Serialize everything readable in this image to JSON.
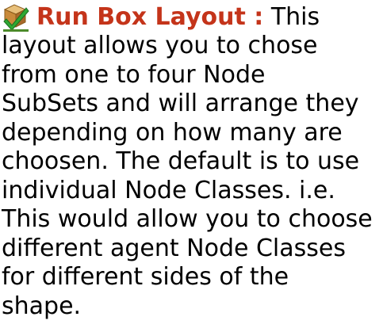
{
  "section": {
    "icon": "green-check-box-icon",
    "heading": "Run Box Layout :",
    "first_line_tail": " This",
    "lines": [
      "layout allows you to chose",
      "from one to four Node",
      "SubSets and will arrange they",
      "depending on how many are",
      "choosen. The default is to use",
      "individual Node Classes. i.e.",
      "This would allow you to choose",
      "different agent Node Classes",
      "for different sides of the",
      "shape."
    ]
  },
  "colors": {
    "heading": "#c4341a",
    "body_text": "#000000"
  }
}
